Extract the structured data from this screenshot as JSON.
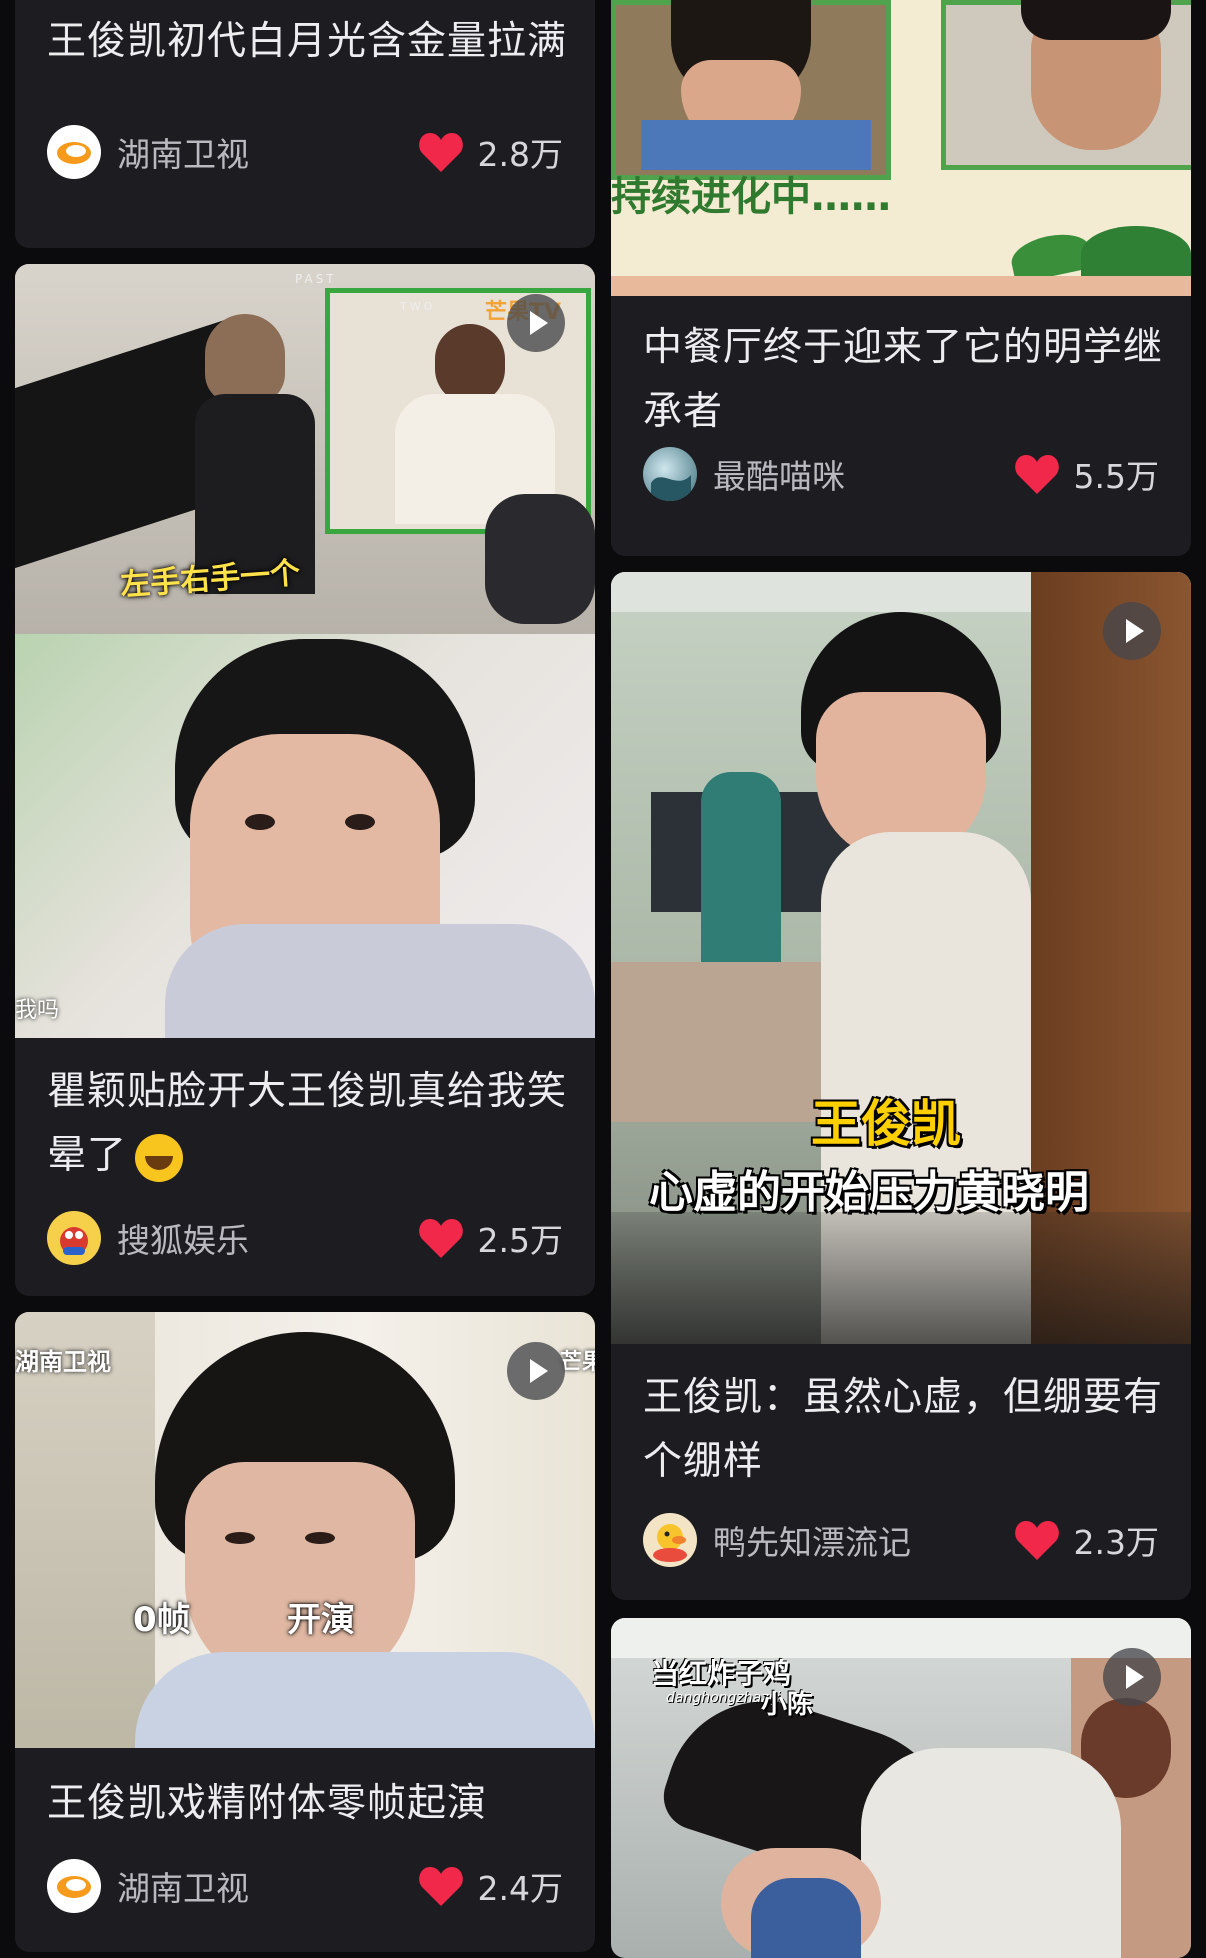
{
  "colors": {
    "background": "#0b0b0d",
    "card": "#1d1d21",
    "heart": "#f2284b"
  },
  "cards": [
    {
      "title": "王俊凯初代白月光含金量拉满",
      "author": "湖南卫视",
      "likes": "2.8万",
      "avatar_icon": "hunan-tv-logo-icon"
    },
    {
      "title": "瞿颖贴脸开大王俊凯真给我笑晕了",
      "author": "搜狐娱乐",
      "likes": "2.5万",
      "avatar_icon": "sohu-avatar-icon",
      "overlay": {
        "caption": "左手右手一个",
        "watermark": "芒果TV",
        "corner_text": "PAST",
        "corner_text2": "TWO",
        "edge_text": "我吗"
      }
    },
    {
      "title": "王俊凯戏精附体零帧起演",
      "author": "湖南卫视",
      "likes": "2.4万",
      "avatar_icon": "hunan-tv-logo-icon",
      "overlay": {
        "watermark": "湖南卫视",
        "caption_left": "0帧",
        "caption_right": "开演",
        "watermark_right": "芒果"
      }
    },
    {
      "title": "中餐厅终于迎来了它的明学继承者",
      "author": "最酷喵咪",
      "likes": "5.5万",
      "avatar_icon": "cat-avatar-icon",
      "overlay": {
        "caption": "持续进化中……"
      }
    },
    {
      "title": "王俊凯：虽然心虚，但绷要有个绷样",
      "author": "鸭先知漂流记",
      "likes": "2.3万",
      "avatar_icon": "duck-avatar-icon",
      "overlay": {
        "caption_top": "王俊凯",
        "caption_bottom": "心虚的开始压力黄晓明"
      }
    },
    {
      "overlay": {
        "caption_top": "当红炸子鸡",
        "caption_sub": "danghongzhaziji",
        "caption_name": "小陈"
      }
    }
  ]
}
